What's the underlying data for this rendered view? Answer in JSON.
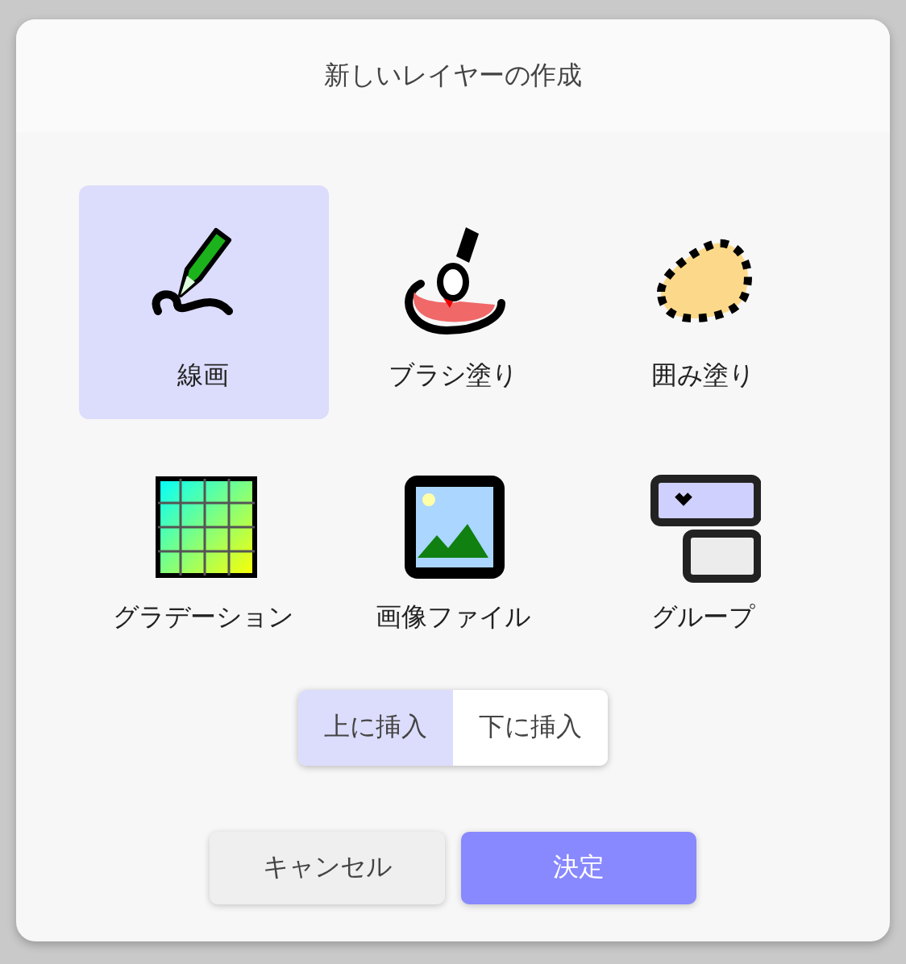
{
  "dialog": {
    "title": "新しいレイヤーの作成"
  },
  "layer_types": [
    {
      "kind": "line",
      "label": "線画",
      "selected": true
    },
    {
      "kind": "brush",
      "label": "ブラシ塗り",
      "selected": false
    },
    {
      "kind": "fill",
      "label": "囲み塗り",
      "selected": false
    },
    {
      "kind": "gradient",
      "label": "グラデーション",
      "selected": false
    },
    {
      "kind": "image",
      "label": "画像ファイル",
      "selected": false
    },
    {
      "kind": "group",
      "label": "グループ",
      "selected": false
    }
  ],
  "insert_position": [
    {
      "label": "上に挿入",
      "selected": true
    },
    {
      "label": "下に挿入",
      "selected": false
    }
  ],
  "buttons": [
    {
      "kind": "cancel",
      "label": "キャンセル"
    },
    {
      "kind": "ok",
      "label": "決定"
    }
  ]
}
